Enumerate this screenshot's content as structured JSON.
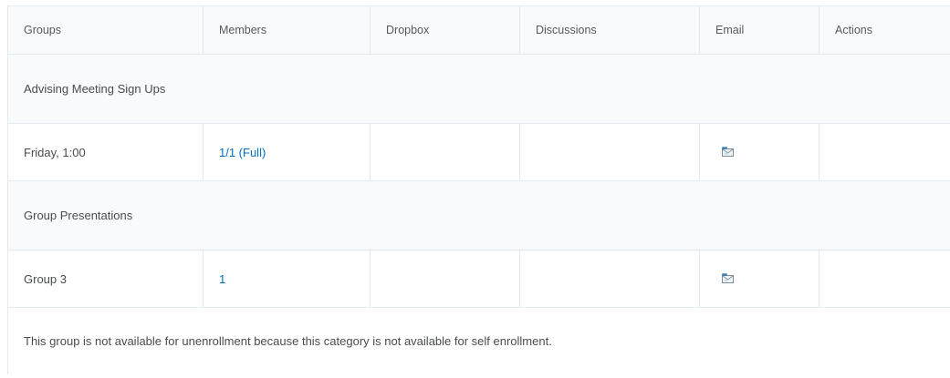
{
  "columns": {
    "groups": "Groups",
    "members": "Members",
    "dropbox": "Dropbox",
    "discussions": "Discussions",
    "email": "Email",
    "actions": "Actions"
  },
  "categories": [
    {
      "name": "Advising Meeting Sign Ups",
      "groups": [
        {
          "name": "Friday, 1:00",
          "members": "1/1 (Full)",
          "email_icon": "email-icon"
        }
      ]
    },
    {
      "name": "Group Presentations",
      "groups": [
        {
          "name": "Group 3",
          "members": "1",
          "email_icon": "email-icon"
        }
      ]
    }
  ],
  "notice": "This group is not available for unenrollment because this category is not available for self enrollment.",
  "colors": {
    "link": "#006fbf",
    "header_bg": "#f9fafb",
    "border": "#e3e9f1",
    "text": "#494c4e"
  }
}
